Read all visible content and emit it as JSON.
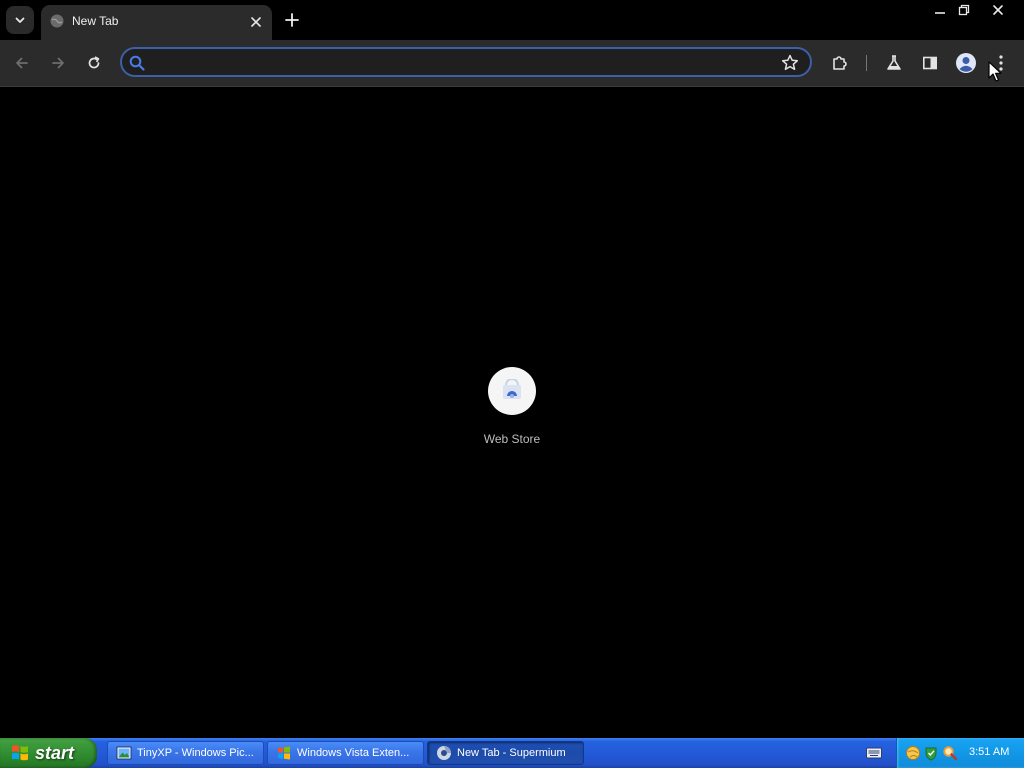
{
  "browser": {
    "tab": {
      "title": "New Tab"
    },
    "omnibox": {
      "value": "",
      "placeholder": ""
    },
    "accent_color": "#3d5fa8"
  },
  "new_tab_page": {
    "shortcuts": [
      {
        "label": "Web Store"
      }
    ]
  },
  "taskbar": {
    "start_label": "start",
    "tasks": [
      {
        "label": "TinyXP - Windows Pic...",
        "icon": "picture-viewer-icon",
        "active": false
      },
      {
        "label": "Windows Vista Exten...",
        "icon": "vista-extender-icon",
        "active": false
      },
      {
        "label": "New Tab - Supermium",
        "icon": "supermium-icon",
        "active": true
      }
    ],
    "clock": "3:51 AM"
  }
}
